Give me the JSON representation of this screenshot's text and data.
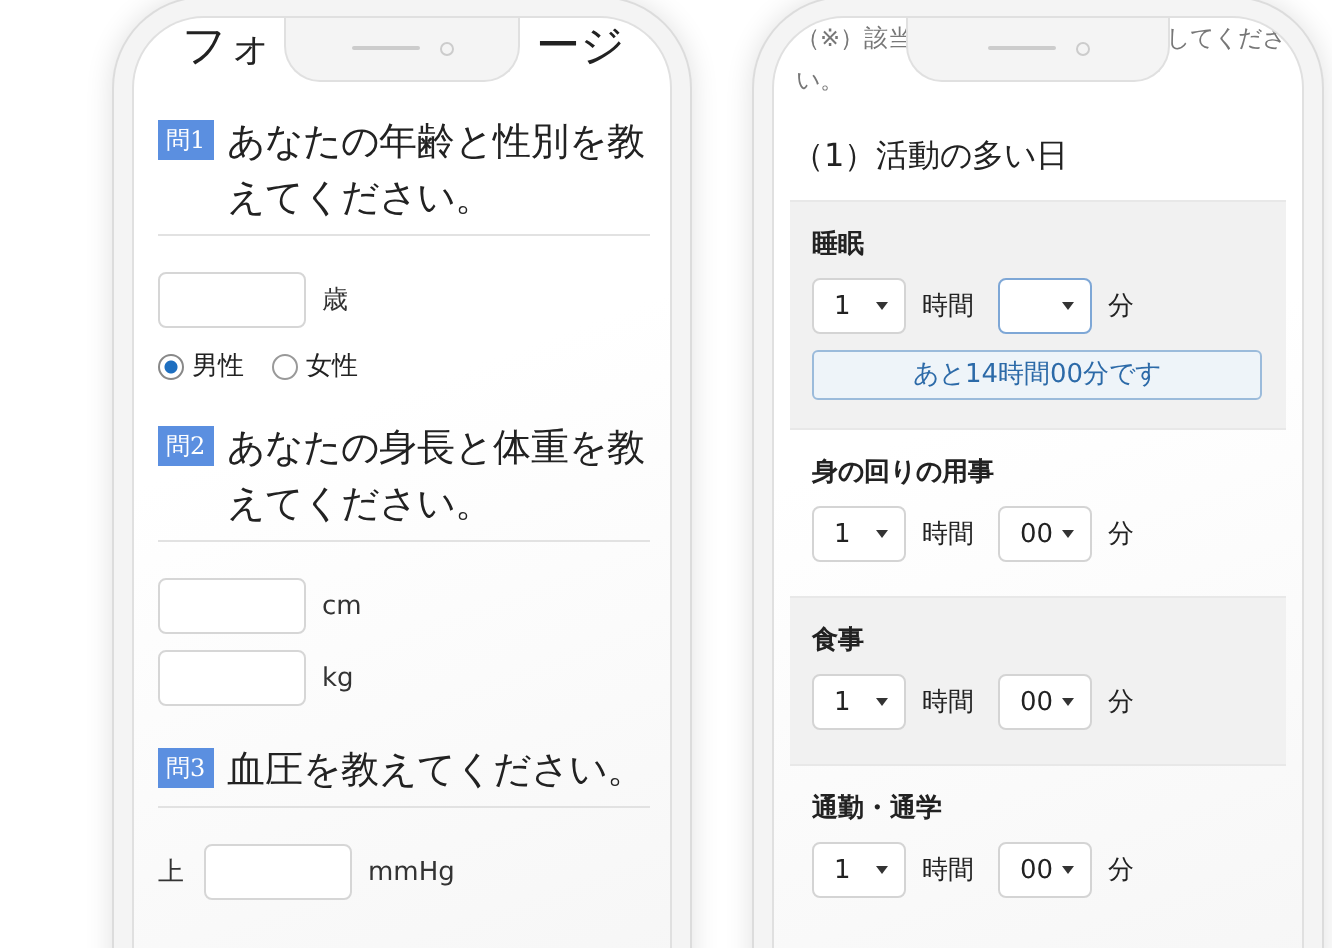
{
  "left_phone": {
    "title_parts": [
      "フォ",
      "ージ"
    ],
    "questions": [
      {
        "badge": "問1",
        "text": "あなたの年齢と性別を教えてください。",
        "fields": [
          {
            "kind": "input",
            "unit": "歳"
          },
          {
            "kind": "radios",
            "options": [
              {
                "label": "男性",
                "selected": true
              },
              {
                "label": "女性",
                "selected": false
              }
            ]
          }
        ]
      },
      {
        "badge": "問2",
        "text": "あなたの身長と体重を教えてください。",
        "fields": [
          {
            "kind": "input",
            "unit": "cm"
          },
          {
            "kind": "input",
            "unit": "kg"
          }
        ]
      },
      {
        "badge": "問3",
        "text": "血圧を教えてください。",
        "fields": [
          {
            "kind": "input",
            "prefix": "上",
            "unit": "mmHg"
          }
        ]
      }
    ]
  },
  "right_phone": {
    "notice": {
      "line_1_parts": [
        "（※）該当",
        "してくださ"
      ],
      "line_2": "い。"
    },
    "heading": "（1）活動の多い日",
    "activities": [
      {
        "label": "睡眠",
        "hours": "1",
        "hours_unit": "時間",
        "minutes_unit": "分",
        "minutes_focused": true,
        "message": "あと14時間00分です"
      },
      {
        "label": "身の回りの用事",
        "hours": "1",
        "hours_unit": "時間",
        "minutes": "00",
        "minutes_unit": "分",
        "minutes_focused": false
      },
      {
        "label": "食事",
        "hours": "1",
        "hours_unit": "時間",
        "minutes": "00",
        "minutes_unit": "分",
        "minutes_focused": false
      },
      {
        "label": "通勤・通学",
        "hours": "1",
        "hours_unit": "時間",
        "minutes": "00",
        "minutes_unit": "分",
        "minutes_focused": false
      }
    ]
  }
}
